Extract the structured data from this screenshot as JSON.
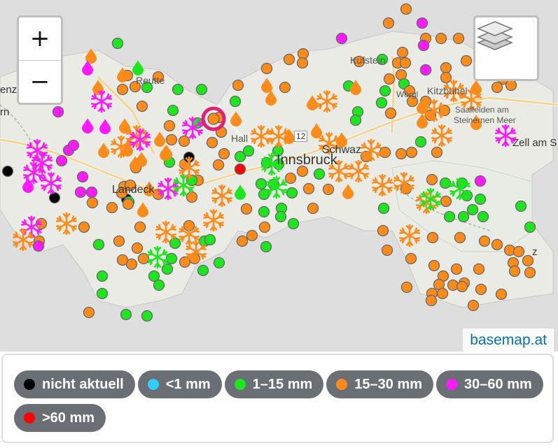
{
  "map": {
    "attribution": "basemap.at",
    "place_labels": [
      "Reutte",
      "Kufstein",
      "Kitzbühel",
      "Saalfelden am",
      "Steinernen Meer",
      "Hall",
      "Schwaz",
      "Innsbruck",
      "Landeck",
      "Zell am S",
      "enz",
      "rn",
      "Wörgl",
      "12",
      "z"
    ]
  },
  "controls": {
    "zoom_in": "+",
    "zoom_out": "−",
    "layers_icon": "layers-icon"
  },
  "legend": {
    "items": [
      {
        "label": "nicht aktuell",
        "color": "#000000"
      },
      {
        "label": "<1 mm",
        "color": "#33ccff"
      },
      {
        "label": "1–15 mm",
        "color": "#1ee61e"
      },
      {
        "label": "15–30 mm",
        "color": "#ff8c1a"
      },
      {
        "label": "30–60 mm",
        "color": "#ff1aff"
      },
      {
        "label": ">60 mm",
        "color": "#ff0000"
      }
    ]
  },
  "colors": {
    "green": "#1ee61e",
    "orange": "#ff8c1a",
    "magenta": "#ff1aff",
    "black": "#000000",
    "red": "#ff0000",
    "chip_bg": "#6b6e74",
    "attribution": "#0a6fa3"
  }
}
